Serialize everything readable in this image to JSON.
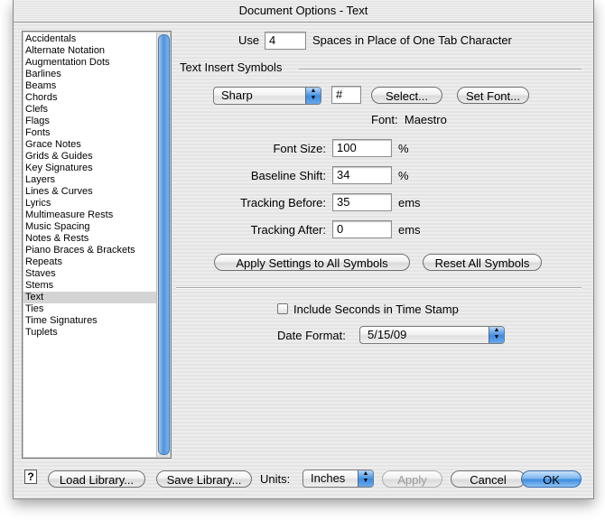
{
  "window": {
    "title": "Document Options - Text"
  },
  "categories": {
    "items": [
      "Accidentals",
      "Alternate Notation",
      "Augmentation Dots",
      "Barlines",
      "Beams",
      "Chords",
      "Clefs",
      "Flags",
      "Fonts",
      "Grace Notes",
      "Grids & Guides",
      "Key Signatures",
      "Layers",
      "Lines & Curves",
      "Lyrics",
      "Multimeasure Rests",
      "Music Spacing",
      "Notes & Rests",
      "Piano Braces & Brackets",
      "Repeats",
      "Staves",
      "Stems",
      "Text",
      "Ties",
      "Time Signatures",
      "Tuplets"
    ],
    "selected": "Text"
  },
  "tab": {
    "use_label": "Use",
    "spaces_value": "4",
    "spaces_label": "Spaces in Place of One Tab Character"
  },
  "symbols": {
    "section_title": "Text Insert Symbols",
    "symbol_popup": "Sharp",
    "symbol_char": "#",
    "select_button": "Select...",
    "set_font_button": "Set Font...",
    "font_label": "Font:",
    "font_name": "Maestro",
    "font_size_label": "Font Size:",
    "font_size_value": "100",
    "font_size_unit": "%",
    "baseline_label": "Baseline Shift:",
    "baseline_value": "34",
    "baseline_unit": "%",
    "tracking_before_label": "Tracking Before:",
    "tracking_before_value": "35",
    "tracking_before_unit": "ems",
    "tracking_after_label": "Tracking After:",
    "tracking_after_value": "0",
    "tracking_after_unit": "ems",
    "apply_all_button": "Apply Settings to All Symbols",
    "reset_all_button": "Reset All Symbols"
  },
  "timestamp": {
    "include_seconds_label": "Include Seconds in Time Stamp",
    "include_seconds_checked": false,
    "date_format_label": "Date Format:",
    "date_format_value": "5/15/09"
  },
  "footer": {
    "help_icon": "?",
    "load_library_button": "Load Library...",
    "save_library_button": "Save Library...",
    "units_label": "Units:",
    "units_value": "Inches",
    "apply_button": "Apply",
    "cancel_button": "Cancel",
    "ok_button": "OK"
  },
  "colors": {
    "accent": "#3f8ce0",
    "selected_row": "#d4d4d4"
  }
}
